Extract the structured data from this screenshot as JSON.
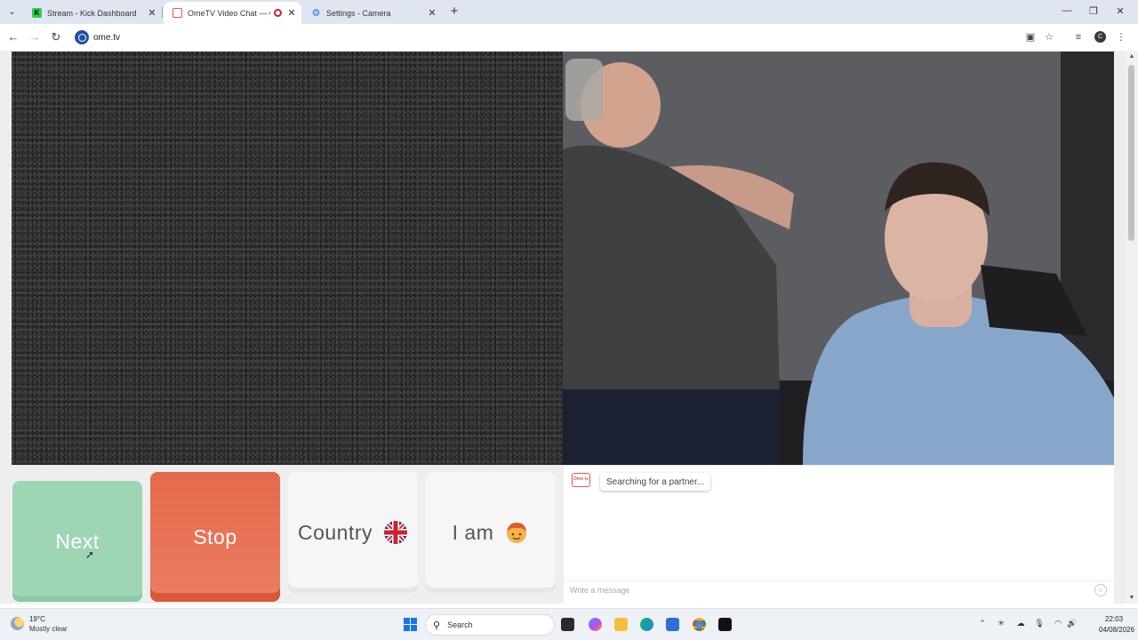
{
  "browser": {
    "tabs": [
      {
        "title": "Stream - Kick Dashboard",
        "active": false
      },
      {
        "title": "OmeTV Video Chat — Ome",
        "active": true
      },
      {
        "title": "Settings - Camera",
        "active": false
      }
    ],
    "new_tab_glyph": "+",
    "url": "ome.tv",
    "profile_initial": "C",
    "window_controls": {
      "minimize": "—",
      "restore": "❐",
      "close": "✕"
    }
  },
  "controls": {
    "next_label": "Next",
    "stop_label": "Stop",
    "country_label": "Country",
    "country_flag": "uk-flag-icon",
    "iam_label": "I am",
    "iam_icon": "boy-face-icon"
  },
  "chat": {
    "status_message": "Searching for a partner...",
    "input_placeholder": "Write a message",
    "logo_text": "Ome tv"
  },
  "taskbar": {
    "weather_temp": "19°C",
    "weather_desc": "Mostly clear",
    "search_label": "Search",
    "time": "22:03",
    "date": "04/08/2026"
  },
  "colors": {
    "next_button": "#9ed6b5",
    "stop_button": "#e86b4e",
    "neutral_button": "#f6f6f6",
    "tab_strip": "#dfe6f1"
  }
}
